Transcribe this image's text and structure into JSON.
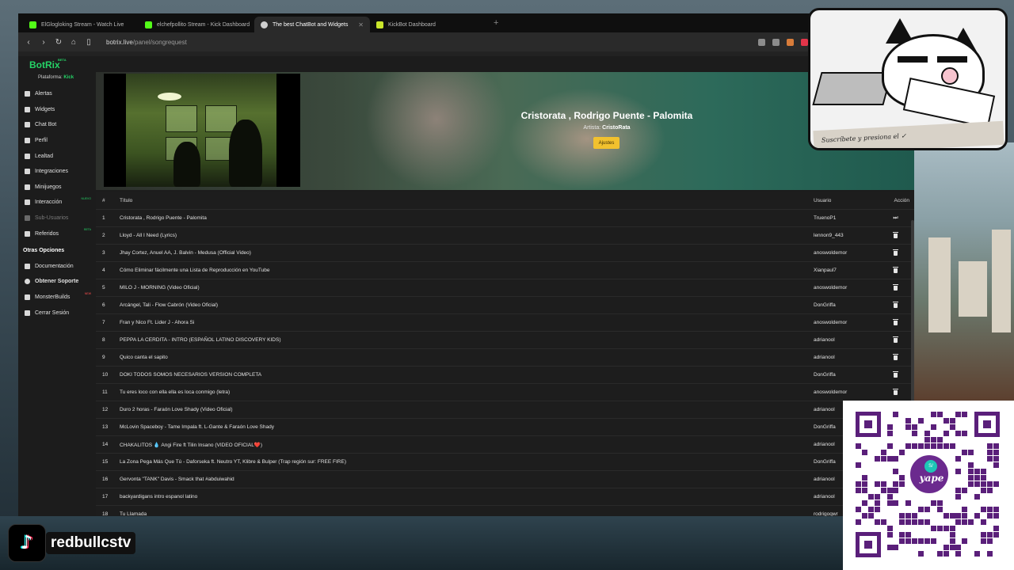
{
  "browser": {
    "tabs": [
      {
        "label": "ElGlogloking Stream - Watch Live",
        "icon": "kick-icon",
        "active": false
      },
      {
        "label": "elchefpollito Stream - Kick Dashboard",
        "icon": "kick-icon",
        "active": false
      },
      {
        "label": "The best ChatBot and Widgets",
        "icon": "botrix-icon",
        "active": true
      },
      {
        "label": "KickBot Dashboard",
        "icon": "kickbot-icon",
        "active": false
      }
    ],
    "new_tab": "+",
    "url_host": "botrix.live",
    "url_path": "/panel/songrequest"
  },
  "sidebar": {
    "logo": "BotRix",
    "logo_badge": "BETA",
    "platform_label": "Plataforma:",
    "platform_value": "Kick",
    "items": [
      {
        "label": "Alertas",
        "icon": "alert-icon",
        "disabled": false,
        "badge": ""
      },
      {
        "label": "Widgets",
        "icon": "widgets-icon",
        "disabled": false,
        "badge": ""
      },
      {
        "label": "Chat Bot",
        "icon": "chat-icon",
        "disabled": false,
        "badge": ""
      },
      {
        "label": "Perfil",
        "icon": "profile-icon",
        "disabled": false,
        "badge": ""
      },
      {
        "label": "Lealtad",
        "icon": "trophy-icon",
        "disabled": false,
        "badge": ""
      },
      {
        "label": "Integraciones",
        "icon": "integrations-icon",
        "disabled": false,
        "badge": ""
      },
      {
        "label": "Minijuegos",
        "icon": "gamepad-icon",
        "disabled": false,
        "badge": ""
      },
      {
        "label": "Interacción",
        "icon": "music-icon",
        "disabled": false,
        "badge": "NUEVO"
      },
      {
        "label": "Sub-Usuarios",
        "icon": "users-icon",
        "disabled": true,
        "badge": ""
      },
      {
        "label": "Referidos",
        "icon": "referral-icon",
        "disabled": false,
        "badge": "BETA"
      }
    ],
    "section_title": "Otras Opciones",
    "other_items": [
      {
        "label": "Documentación",
        "icon": "docs-icon",
        "badge": ""
      },
      {
        "label": "Obtener Soporte",
        "icon": "support-icon",
        "badge": ""
      },
      {
        "label": "MonsterBuilds",
        "icon": "store-icon",
        "badge": "NEW"
      },
      {
        "label": "Cerrar Sesión",
        "icon": "logout-icon",
        "badge": ""
      }
    ]
  },
  "player": {
    "title": "Cristorata , Rodrigo Puente - Palomita",
    "artist_label": "Artista:",
    "artist": "CristoRata",
    "settings_button": "Ajustes"
  },
  "queue": {
    "headers": {
      "num": "#",
      "title": "Título",
      "user": "Usuario",
      "action": "Acción"
    },
    "rows": [
      {
        "num": "1",
        "title": "Cristorata , Rodrigo Puente - Palomita",
        "user": "TruenoP1",
        "action": "skip"
      },
      {
        "num": "2",
        "title": "Lloyd - All I Need (Lyrics)",
        "user": "lennon9_443",
        "action": "delete"
      },
      {
        "num": "3",
        "title": "Jhay Cortez, Anuel AA, J. Balvin - Medusa (Official Video)",
        "user": "anoswoldemor",
        "action": "delete"
      },
      {
        "num": "4",
        "title": "Cómo Eliminar fácilmente una Lista de Reproducción en YouTube",
        "user": "Xianpaul7",
        "action": "delete"
      },
      {
        "num": "5",
        "title": "MILO J - MORNING (Video Oficial)",
        "user": "anoswoldemor",
        "action": "delete"
      },
      {
        "num": "6",
        "title": "Arcángel, Tali - Flow Cabrón (Video Oficial)",
        "user": "DonGriffa",
        "action": "delete"
      },
      {
        "num": "7",
        "title": "Fran y Nico Ft. Lider J - Ahora Si",
        "user": "anoswoldemor",
        "action": "delete"
      },
      {
        "num": "8",
        "title": "PEPPA LA CERDITA - INTRO (ESPAÑOL LATINO DISCOVERY KIDS)",
        "user": "adrianool",
        "action": "delete"
      },
      {
        "num": "9",
        "title": "Quico canta el sapito",
        "user": "adrianool",
        "action": "delete"
      },
      {
        "num": "10",
        "title": "DOKI TODOS SOMOS NECESARIOS VERSION COMPLETA",
        "user": "DonGriffa",
        "action": "delete"
      },
      {
        "num": "11",
        "title": "Tu eres loco con ella ella es loca conmigo (letra)",
        "user": "anoswoldemor",
        "action": "delete"
      },
      {
        "num": "12",
        "title": "Duro 2 horas - Faraón Love Shady (Video Oficial)",
        "user": "adrianool",
        "action": "delete"
      },
      {
        "num": "13",
        "title": "McLovin Spaceboy - Tame Impala ft. L-Gante & Faraón Love Shady",
        "user": "DonGriffa",
        "action": "delete"
      },
      {
        "num": "14",
        "title": "CHAKALITOS 💧 Angi Fire ft Tilin Insano (VIDEO OFICIAL❤️)",
        "user": "adrianool",
        "action": "delete"
      },
      {
        "num": "15",
        "title": "La Zona Pega Más Que Tú - Daforseka ft. Neutro YT, Klibre & Bulper (Trap región sur: FREE FIRE)",
        "user": "DonGriffa",
        "action": "delete"
      },
      {
        "num": "16",
        "title": "Gervonta \"TANK\" Davis - Smack that #abduiwahid",
        "user": "adrianool",
        "action": "delete"
      },
      {
        "num": "17",
        "title": "backyardigans intro espanol latino",
        "user": "adrianool",
        "action": "delete"
      },
      {
        "num": "18",
        "title": "Tu Llamada",
        "user": "rodrigoqwr",
        "action": "delete"
      }
    ]
  },
  "overlays": {
    "sticker_text": "Suscríbete y presiona el ✓",
    "yape_label": "yape",
    "yape_coin": "S/",
    "tiktok_name": "redbullcstv"
  },
  "colors": {
    "brand": "#25d366",
    "accent_button": "#f2c12e",
    "yape_purple": "#5a1f7a"
  }
}
